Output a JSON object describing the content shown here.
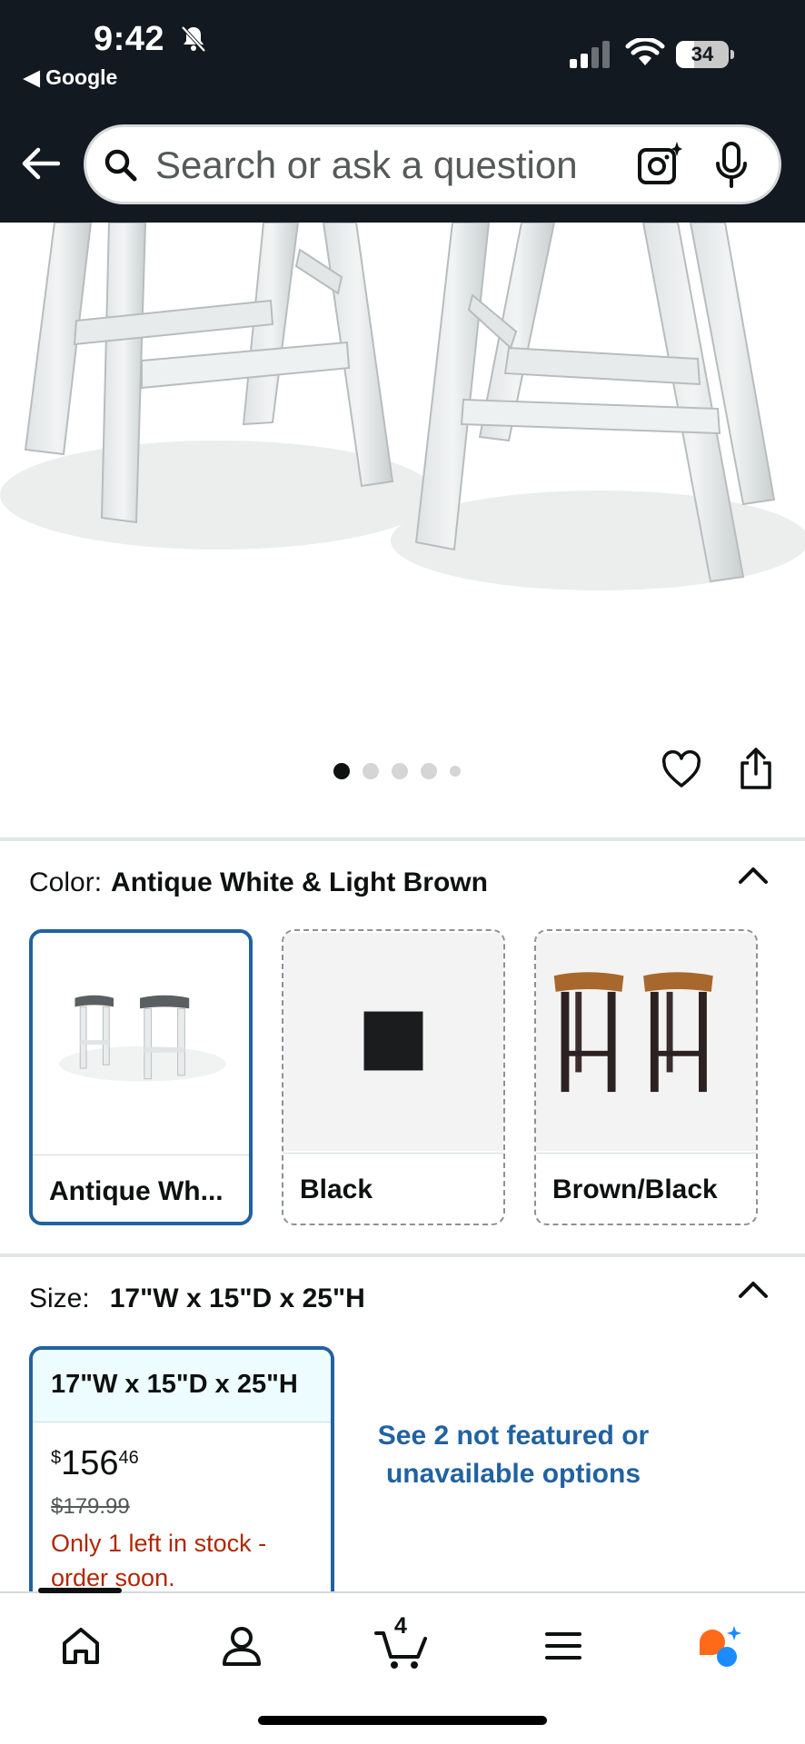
{
  "status_bar": {
    "time": "9:42",
    "back_app": "◀ Google",
    "battery_percent": "34",
    "battery_level": 0.34
  },
  "header": {
    "search_placeholder": "Search or ask a question"
  },
  "gallery": {
    "total_images": 5,
    "active_index": 0
  },
  "color": {
    "label": "Color:",
    "selected": "Antique White & Light Brown",
    "options": [
      {
        "label": "Antique Wh...",
        "selected": true
      },
      {
        "label": "Black",
        "selected": false
      },
      {
        "label": "Brown/Black",
        "selected": false
      }
    ]
  },
  "size": {
    "label": "Size:",
    "selected": "17\"W x 15\"D x 25\"H",
    "card": {
      "title": "17\"W x 15\"D x 25\"H",
      "price_symbol": "$",
      "price_whole": "156",
      "price_fraction": "46",
      "list_price": "$179.99",
      "stock_message": "Only 1 left in stock - order soon."
    },
    "see_more": "See 2 not featured or unavailable options"
  },
  "bottom_nav": {
    "cart_count": "4",
    "tabs": [
      "home-icon",
      "account-icon",
      "cart-icon",
      "menu-icon",
      "rufus-icon"
    ]
  },
  "colors": {
    "header_bg": "#131921",
    "selection_blue": "#2162a1",
    "stock_red": "#b12704",
    "rufus_orange": "#ff6a1a",
    "rufus_blue": "#1a8cff"
  }
}
